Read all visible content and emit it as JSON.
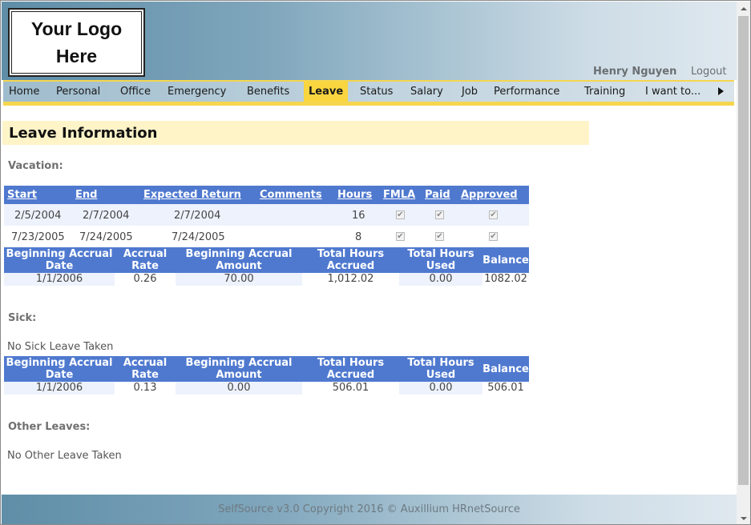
{
  "header": {
    "logo_line1": "Your Logo",
    "logo_line2": "Here",
    "user_name": "Henry Nguyen",
    "logout_label": "Logout"
  },
  "nav": {
    "items": [
      "Home",
      "Personal",
      "Office",
      "Emergency",
      "Benefits",
      "Leave",
      "Status",
      "Salary",
      "Job",
      "Performance",
      "Training",
      "I want to..."
    ],
    "active": "Leave"
  },
  "page": {
    "title": "Leave Information"
  },
  "vacation": {
    "label": "Vacation:",
    "columns": [
      "Start",
      "End",
      "Expected Return",
      "Comments",
      "Hours",
      "FMLA",
      "Paid",
      "Approved"
    ],
    "rows": [
      {
        "start": "2/5/2004",
        "end": "2/7/2004",
        "expected_return": "2/7/2004",
        "comments": "",
        "hours": "16",
        "fmla": true,
        "paid": true,
        "approved": true
      },
      {
        "start": "7/23/2005",
        "end": "7/24/2005",
        "expected_return": "7/24/2005",
        "comments": "",
        "hours": "8",
        "fmla": true,
        "paid": true,
        "approved": true
      }
    ],
    "accrual": {
      "headers": [
        "Beginning Accrual Date",
        "Accrual Rate",
        "Beginning Accrual Amount",
        "Total Hours Accrued",
        "Total Hours Used",
        "Balance"
      ],
      "values": [
        "1/1/2006",
        "0.26",
        "70.00",
        "1,012.02",
        "0.00",
        "1082.02"
      ]
    }
  },
  "sick": {
    "label": "Sick:",
    "empty_message": "No Sick Leave Taken",
    "accrual": {
      "headers": [
        "Beginning Accrual Date",
        "Accrual Rate",
        "Beginning Accrual Amount",
        "Total Hours Accrued",
        "Total Hours Used",
        "Balance"
      ],
      "values": [
        "1/1/2006",
        "0.13",
        "0.00",
        "506.01",
        "0.00",
        "506.01"
      ]
    }
  },
  "other": {
    "label": "Other Leaves:",
    "empty_message": "No Other Leave Taken"
  },
  "footer": {
    "text": "SelfSource v3.0 Copyright 2016 © Auxillium HRnetSource"
  },
  "colors": {
    "table_header": "#4f79cf",
    "nav_active": "#f9d53f",
    "title_bar": "#fef4c8"
  }
}
